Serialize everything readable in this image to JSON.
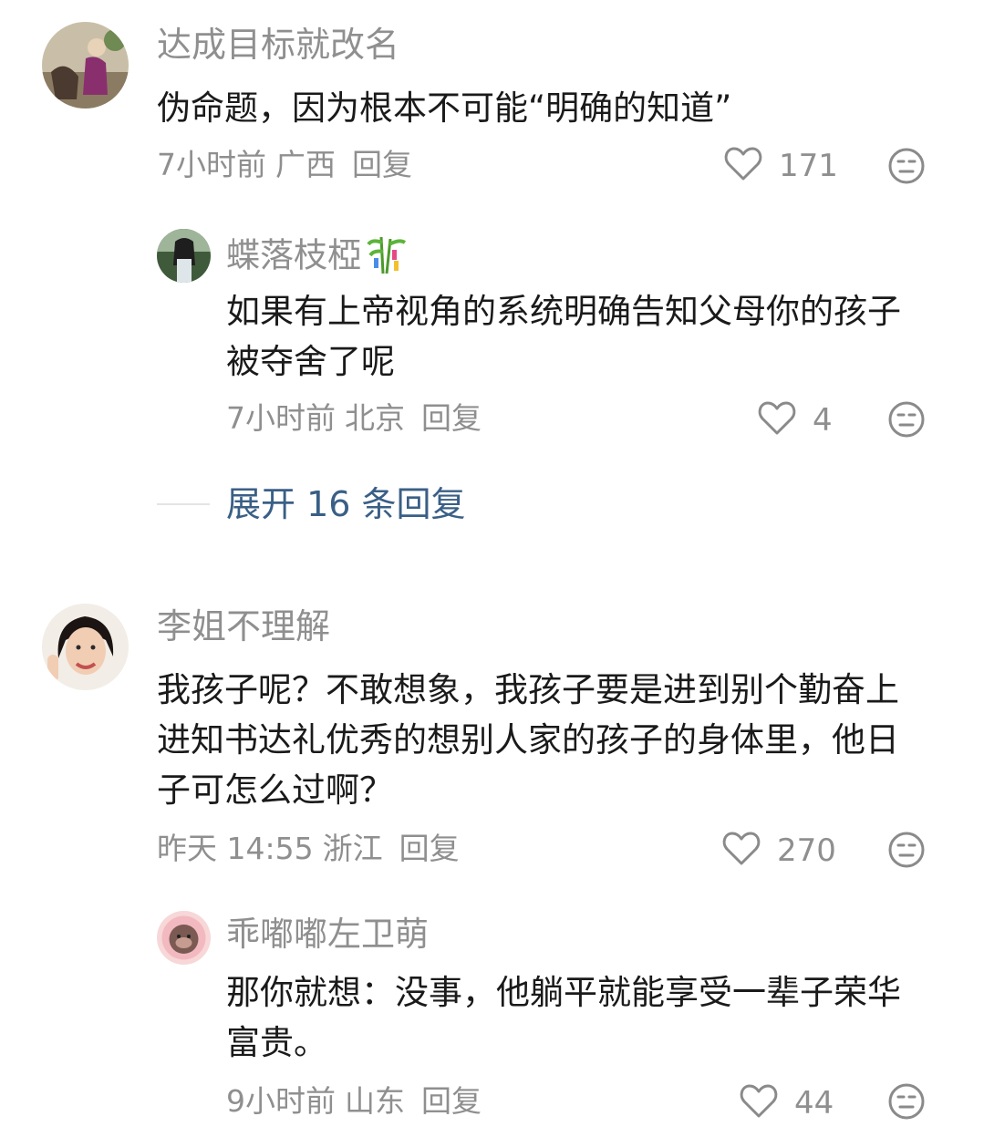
{
  "comments": [
    {
      "author": "达成目标就改名",
      "text": "伪命题，因为根本不可能“明确的知道”",
      "time": "7小时前",
      "location": "广西",
      "reply_label": "回复",
      "likes": "171",
      "replies": [
        {
          "author": "蝶落枝椏",
          "text": "如果有上帝视角的系统明确告知父母你的孩子被夺舍了呢",
          "time": "7小时前",
          "location": "北京",
          "reply_label": "回复",
          "likes": "4"
        }
      ],
      "expand_label": "展开 16 条回复"
    },
    {
      "author": "李姐不理解",
      "text": "我孩子呢？不敢想象，我孩子要是进到别个勤奋上进知书达礼优秀的想别人家的孩子的身体里，他日子可怎么过啊？",
      "time": "昨天 14:55",
      "location": "浙江",
      "reply_label": "回复",
      "likes": "270",
      "replies": [
        {
          "author": "乖嘟嘟左卫萌",
          "text": "那你就想：没事，他躺平就能享受一辈子荣华富贵。",
          "time": "9小时前",
          "location": "山东",
          "reply_label": "回复",
          "likes": "44"
        }
      ]
    }
  ],
  "colors": {
    "meta_gray": "#8f8f8f",
    "text": "#1a1a1a",
    "expand_link": "#3a5f86"
  },
  "icons": [
    "heart-outline-icon",
    "dislike-face-icon",
    "bamboo-emoji-icon"
  ]
}
